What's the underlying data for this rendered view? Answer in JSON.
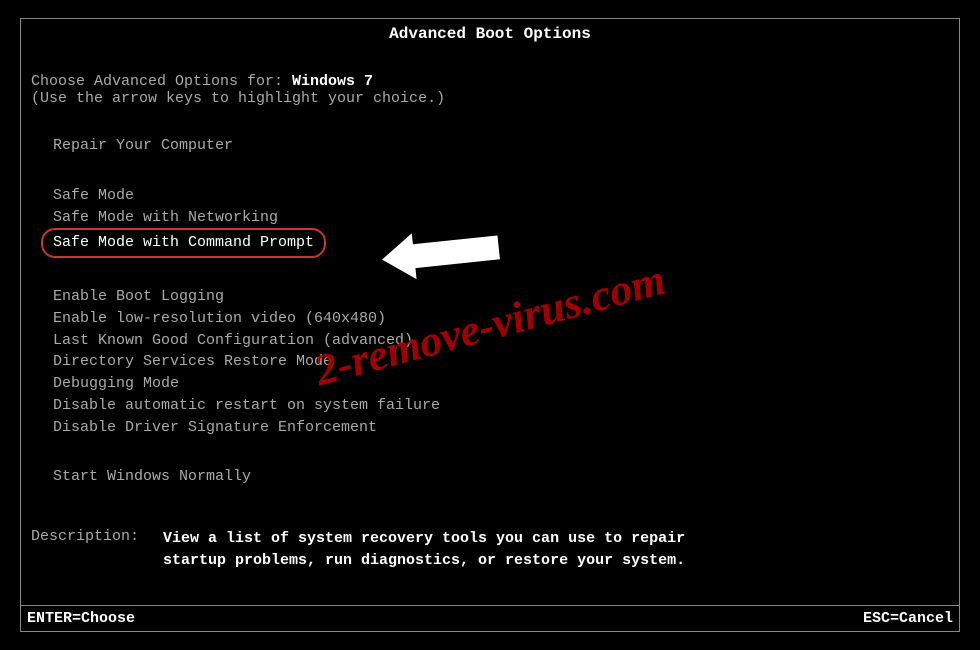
{
  "title": "Advanced Boot Options",
  "intro": {
    "prefix": "Choose Advanced Options for: ",
    "os_name": "Windows 7",
    "hint": "(Use the arrow keys to highlight your choice.)"
  },
  "menu": {
    "repair": "Repair Your Computer",
    "safe_mode": "Safe Mode",
    "safe_mode_net": "Safe Mode with Networking",
    "safe_mode_cmd": "Safe Mode with Command Prompt",
    "boot_logging": "Enable Boot Logging",
    "low_res": "Enable low-resolution video (640x480)",
    "last_known": "Last Known Good Configuration (advanced)",
    "ds_restore": "Directory Services Restore Mode",
    "debugging": "Debugging Mode",
    "disable_restart": "Disable automatic restart on system failure",
    "disable_sig": "Disable Driver Signature Enforcement",
    "start_normal": "Start Windows Normally"
  },
  "description": {
    "label": "Description:",
    "text_line1": "View a list of system recovery tools you can use to repair",
    "text_line2": "startup problems, run diagnostics, or restore your system."
  },
  "footer": {
    "enter": "ENTER=Choose",
    "esc": "ESC=Cancel"
  },
  "watermark": "2-remove-virus.com",
  "colors": {
    "highlight_border": "#cc3333",
    "watermark_color": "#aa0000"
  }
}
